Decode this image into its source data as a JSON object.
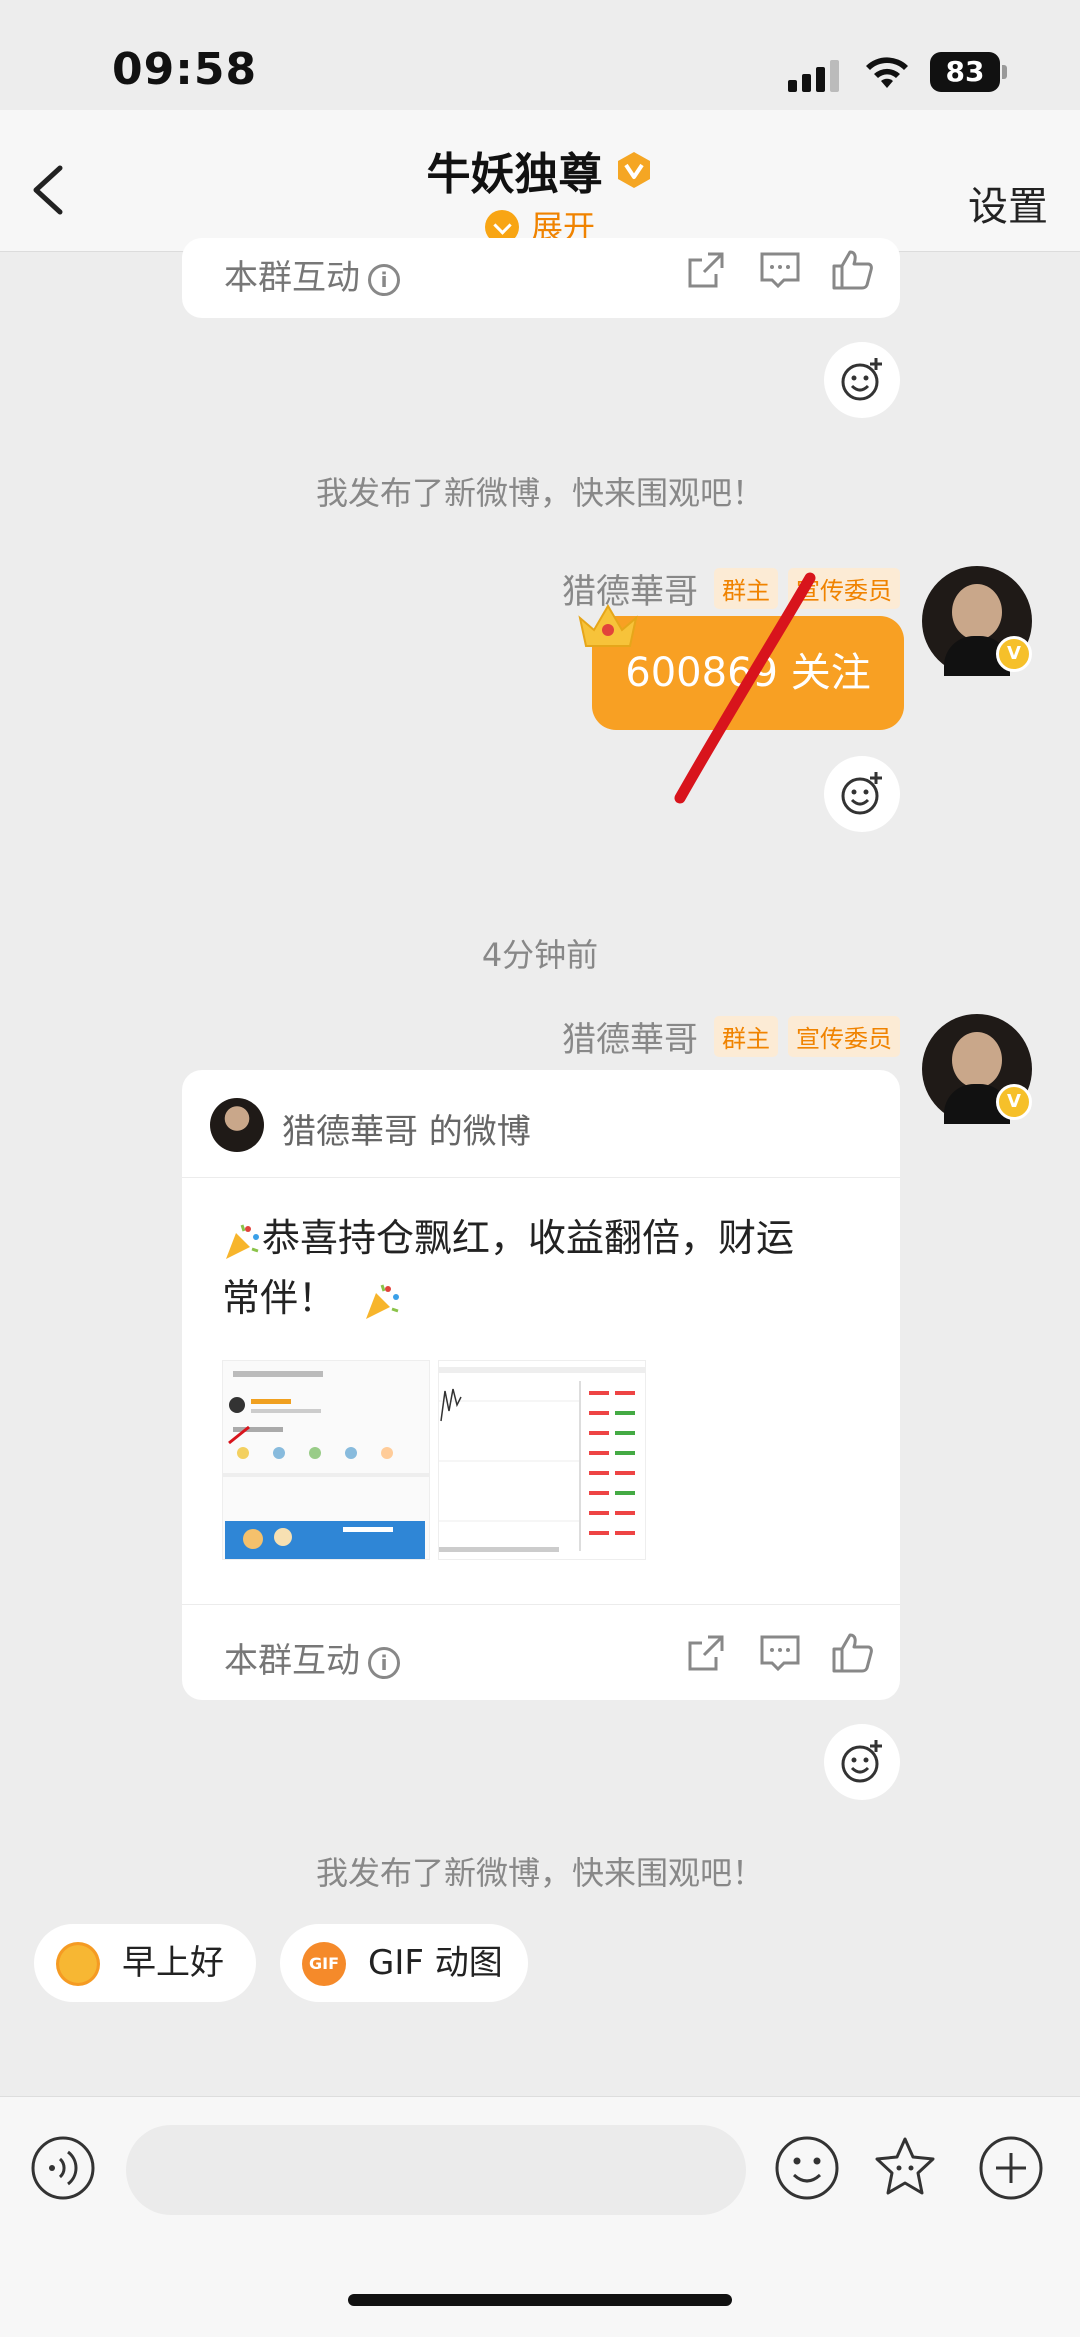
{
  "status": {
    "time": "09:58",
    "battery": "83"
  },
  "header": {
    "title": "牛妖独尊",
    "expand": "展开",
    "settings": "设置"
  },
  "cards": [
    {
      "interact_label": "本群互动"
    },
    {
      "interact_label": "本群互动"
    }
  ],
  "system_messages": [
    "我发布了新微博，快来围观吧！",
    "我发布了新微博，快来围观吧！"
  ],
  "time_divider": "4分钟前",
  "messages": [
    {
      "sender": "猎德華哥",
      "badges": [
        "群主",
        "宣传委员"
      ],
      "text": "600869 关注"
    },
    {
      "sender": "猎德華哥",
      "badges": [
        "群主",
        "宣传委员"
      ]
    }
  ],
  "weibo_card": {
    "title": "猎德華哥 的微博",
    "text_line1": "恭喜持仓飘红，收益翻倍，财运",
    "text_line2": "常伴！"
  },
  "quick_replies": [
    "早上好",
    "GIF 动图"
  ],
  "input": {
    "placeholder": ""
  },
  "colors": {
    "accent": "#f8a023",
    "badge_text": "#f08300",
    "background": "#ededed"
  }
}
